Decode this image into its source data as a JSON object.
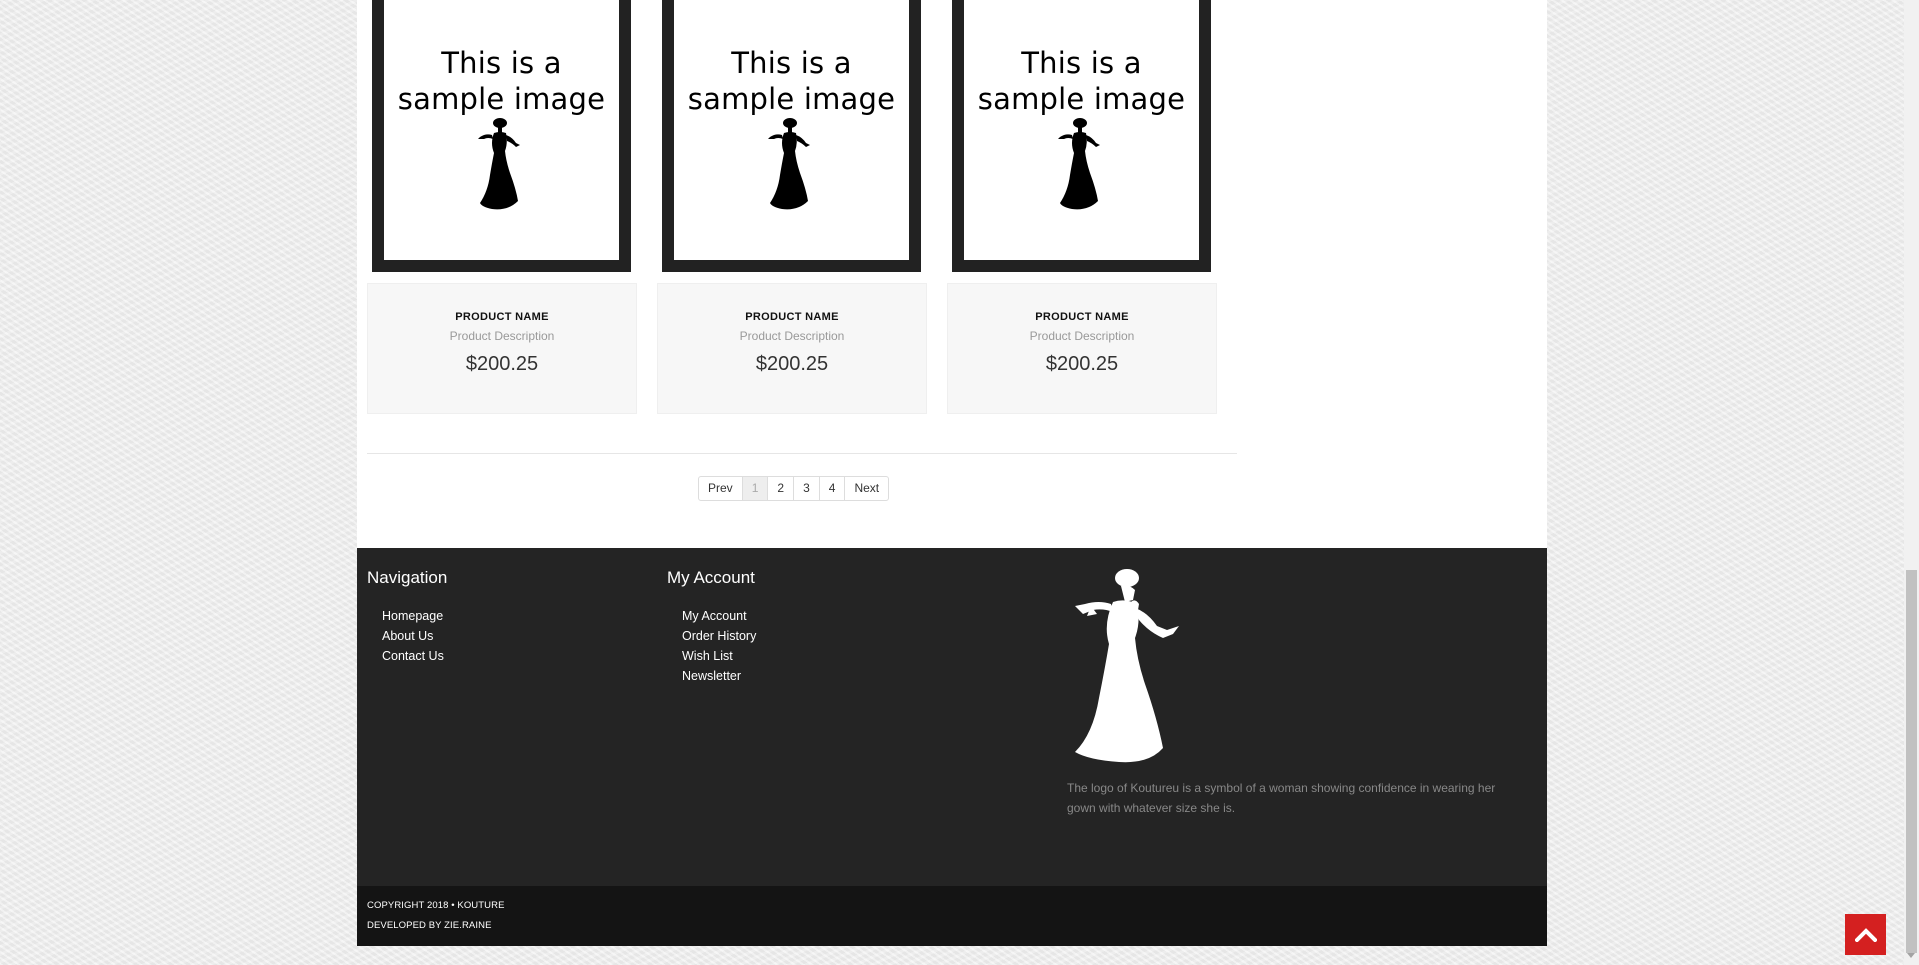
{
  "products": [
    {
      "image_line1": "This is a",
      "image_line2": "sample image",
      "name": "PRODUCT NAME",
      "description": "Product Description",
      "price": "$200.25"
    },
    {
      "image_line1": "This is a",
      "image_line2": "sample image",
      "name": "PRODUCT NAME",
      "description": "Product Description",
      "price": "$200.25"
    },
    {
      "image_line1": "This is a",
      "image_line2": "sample image",
      "name": "PRODUCT NAME",
      "description": "Product Description",
      "price": "$200.25"
    }
  ],
  "pagination": {
    "prev": "Prev",
    "pages": [
      "1",
      "2",
      "3",
      "4"
    ],
    "active_page": "1",
    "next": "Next"
  },
  "footer": {
    "navigation": {
      "heading": "Navigation",
      "items": [
        "Homepage",
        "About Us",
        "Contact Us"
      ]
    },
    "account": {
      "heading": "My Account",
      "items": [
        "My Account",
        "Order History",
        "Wish List",
        "Newsletter"
      ]
    },
    "logo_description": "The logo of Koutureu is a symbol of a woman showing confidence in wearing her gown with whatever size she is."
  },
  "copyright": {
    "line1": "COPYRIGHT 2018 • KOUTURE",
    "line2": "DEVELOPED BY ZIE.RAINE"
  },
  "icons": {
    "scroll_top": "chevron-up-icon",
    "logo": "woman-in-gown-silhouette"
  },
  "colors": {
    "footer_bg": "#242424",
    "copyright_bg": "#141414",
    "scroll_top_bg": "#d42020"
  }
}
